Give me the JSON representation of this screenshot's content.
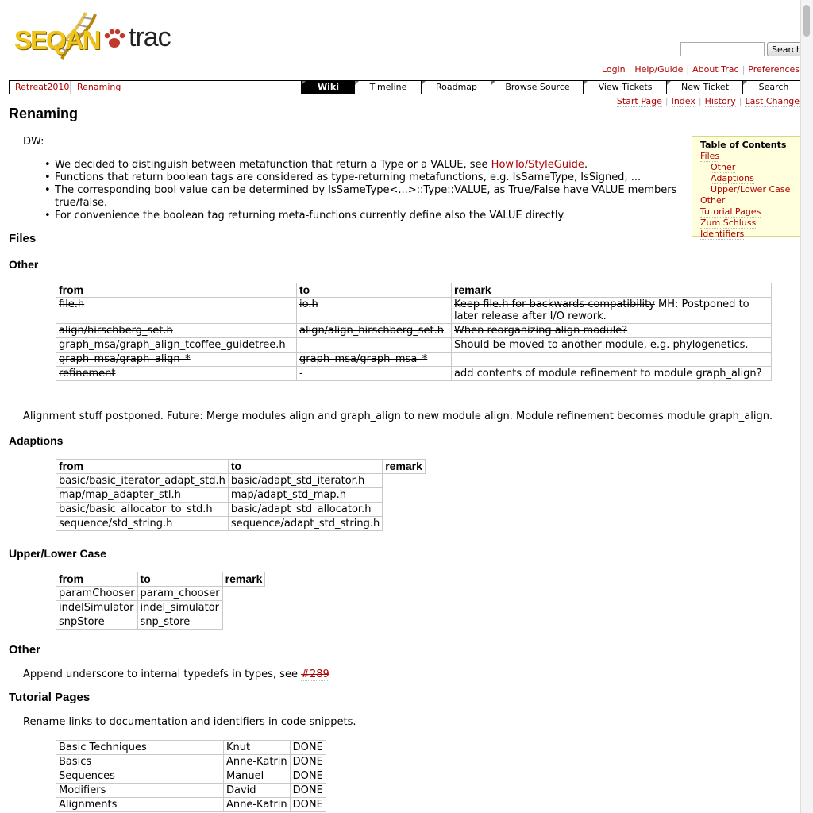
{
  "logo": {
    "text_seqan": "SEQAN",
    "text_trac": "trac"
  },
  "search": {
    "placeholder": "",
    "button": "Search"
  },
  "metanav": [
    "Login",
    "Help/Guide",
    "About Trac",
    "Preferences"
  ],
  "breadcrumbs": [
    "Retreat2010",
    "Renaming"
  ],
  "mainnav": [
    "Wiki",
    "Timeline",
    "Roadmap",
    "Browse Source",
    "View Tickets",
    "New Ticket",
    "Search"
  ],
  "active_tab": "Wiki",
  "ctxtnav": [
    "Start Page",
    "Index",
    "History",
    "Last Change"
  ],
  "page": {
    "title": "Renaming",
    "intro": "DW:",
    "bullets": [
      {
        "text": "We decided to distinguish between metafunction that return a Type or a VALUE, see ",
        "link": "HowTo/StyleGuide",
        "after": "."
      },
      {
        "text": "Functions that return boolean tags are considered as type-returning metafunctions, e.g. IsSameType, IsSigned, ...",
        "link": "",
        "after": ""
      },
      {
        "text": "The corresponding bool value can be determined by IsSameType<...>::Type::VALUE, as True/False have VALUE members true/false.",
        "link": "",
        "after": ""
      },
      {
        "text": "For convenience the boolean tag returning meta-functions currently define also the VALUE directly.",
        "link": "",
        "after": ""
      }
    ],
    "files_heading": "Files",
    "other_heading": "Other",
    "other_table": {
      "headers": [
        "from",
        "to",
        "remark"
      ],
      "rows": [
        [
          "file.h",
          "io.h",
          "Keep file.h for backwards compatibility",
          " MH: Postponed to later release after I/O rework."
        ],
        [
          "align/hirschberg_set.h",
          "align/align_hirschberg_set.h",
          "When reorganizing align module?",
          ""
        ],
        [
          "graph_msa/graph_align_tcoffee_guidetree.h",
          "",
          "Should be moved to another module, e.g. phylogenetics.",
          ""
        ],
        [
          "graph_msa/graph_align_*",
          "graph_msa/graph_msa_*",
          "",
          ""
        ],
        [
          "refinement",
          "-",
          "",
          "add contents of module refinement to module graph_align?"
        ]
      ]
    },
    "alignment_note": "Alignment stuff postponed. Future: Merge modules align and graph_align to new module align. Module refinement becomes module graph_align.",
    "adaptions_heading": "Adaptions",
    "adaptions_table": {
      "headers": [
        "from",
        "to",
        "remark"
      ],
      "rows": [
        [
          "basic/basic_iterator_adapt_std.h",
          "basic/adapt_std_iterator.h"
        ],
        [
          "map/map_adapter_stl.h",
          "map/adapt_std_map.h"
        ],
        [
          "basic/basic_allocator_to_std.h",
          "basic/adapt_std_allocator.h"
        ],
        [
          "sequence/std_string.h",
          "sequence/adapt_std_string.h"
        ]
      ]
    },
    "case_heading": "Upper/Lower Case",
    "case_table": {
      "headers": [
        "from",
        "to",
        "remark"
      ],
      "rows": [
        [
          "paramChooser",
          "param_chooser"
        ],
        [
          "indelSimulator",
          "indel_simulator"
        ],
        [
          "snpStore",
          "snp_store"
        ]
      ]
    },
    "other2_heading": "Other",
    "other2_text": "Append underscore to internal typedefs in types, see ",
    "other2_link": "#289",
    "tutorial_heading": "Tutorial Pages",
    "tutorial_text": "Rename links to documentation and identifiers in code snippets.",
    "tutorial_table": [
      [
        "Basic Techniques",
        "Knut",
        "DONE"
      ],
      [
        "Basics",
        "Anne-Katrin",
        "DONE"
      ],
      [
        "Sequences",
        "Manuel",
        "DONE"
      ],
      [
        "Modifiers",
        "David",
        "DONE"
      ],
      [
        "Alignments",
        "Anne-Katrin",
        "DONE"
      ]
    ]
  },
  "toc": {
    "title": "Table of Contents",
    "items": [
      "Files",
      "Other",
      "Adaptions",
      "Upper/Lower Case",
      "Other",
      "Tutorial Pages",
      "Zum Schluss",
      "Identifiers"
    ]
  },
  "colors": {
    "link": "#b00000",
    "toc_bg": "#ffffdd",
    "nav_active": "#000000",
    "logo_yellow": "#f0c419"
  }
}
